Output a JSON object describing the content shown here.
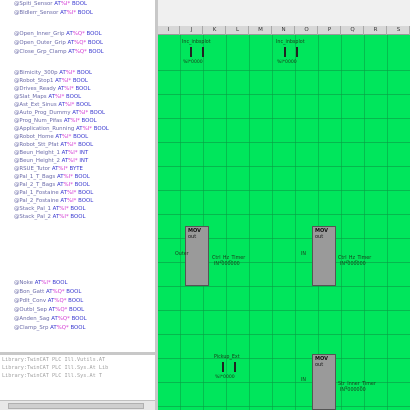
{
  "variables": [
    {
      "name": "@Spiti_Sensor",
      "at": "AT",
      "addr": "%I*",
      "type": "BOOL"
    },
    {
      "name": "@Bldlerr_Sensor",
      "at": "AT",
      "addr": "%I*",
      "type": "BOOL"
    },
    {
      "name": "@Open_Inner_Grip",
      "at": "AT",
      "addr": "%Q*",
      "type": "BOOL"
    },
    {
      "name": "@Open_Outer_Grip",
      "at": "AT",
      "addr": "%Q*",
      "type": "BOOL"
    },
    {
      "name": "@Close_Grp_Clamp",
      "at": "AT",
      "addr": "%Q*",
      "type": "BOOL"
    },
    {
      "name": "@Bimicity_300p",
      "at": "AT",
      "addr": "%I*",
      "type": "BOOL"
    },
    {
      "name": "@Robot_Stop1",
      "at": "AT",
      "addr": "%I*",
      "type": "BOOL"
    },
    {
      "name": "@Drives_Ready",
      "at": "AT",
      "addr": "%I*",
      "type": "BOOL"
    },
    {
      "name": "@Slat_Maps",
      "at": "AT",
      "addr": "%I*",
      "type": "BOOL"
    },
    {
      "name": "@Ast_Ext_Sinus",
      "at": "AT",
      "addr": "%I*",
      "type": "BOOL"
    },
    {
      "name": "@Auto_Prog_Dummy",
      "at": "AT",
      "addr": "%I*",
      "type": "BOOL"
    },
    {
      "name": "@Prog_Num_Pifas",
      "at": "AT",
      "addr": "%I*",
      "type": "BOOL"
    },
    {
      "name": "@Application_Running",
      "at": "AT",
      "addr": "%I*",
      "type": "BOOL"
    },
    {
      "name": "@Robot_Home",
      "at": "AT",
      "addr": "%I*",
      "type": "BOOL"
    },
    {
      "name": "@Robot_Stt_Pfat",
      "at": "AT",
      "addr": "%I*",
      "type": "BOOL"
    },
    {
      "name": "@Beun_Height_1",
      "at": "AT",
      "addr": "%I*",
      "type": "INT"
    },
    {
      "name": "@Beun_Height_2",
      "at": "AT",
      "addr": "%I*",
      "type": "INT"
    },
    {
      "name": "@RSUE_Tutor",
      "at": "AT",
      "addr": "%I*",
      "type": "BYTE"
    },
    {
      "name": "@Pal_1_T_Bags",
      "at": "AT",
      "addr": "%I*",
      "type": "BOOL"
    },
    {
      "name": "@Pal_2_T_Bags",
      "at": "AT",
      "addr": "%I*",
      "type": "BOOL"
    },
    {
      "name": "@Pal_1_Fostaine",
      "at": "AT",
      "addr": "%I*",
      "type": "BOOL"
    },
    {
      "name": "@Pal_2_Fostaine",
      "at": "AT",
      "addr": "%I*",
      "type": "BOOL"
    },
    {
      "name": "@Stack_Pal_1",
      "at": "AT",
      "addr": "%I*",
      "type": "BOOL"
    },
    {
      "name": "@Stack_Pal_2",
      "at": "AT",
      "addr": "%I*",
      "type": "BOOL"
    },
    {
      "name": "@Noke",
      "at": "AT",
      "addr": "%I*",
      "type": "BOOL"
    },
    {
      "name": "@Bon_Gatt",
      "at": "AT",
      "addr": "%Q*",
      "type": "BOOL"
    },
    {
      "name": "@Pdlt_Conv",
      "at": "AT",
      "addr": "%Q*",
      "type": "BOOL"
    },
    {
      "name": "@Outbl_Sep",
      "at": "AT",
      "addr": "%Q*",
      "type": "BOOL"
    },
    {
      "name": "@Anden_Sag",
      "at": "AT",
      "addr": "%Q*",
      "type": "BOOL"
    },
    {
      "name": "@Clamp_Srp",
      "at": "AT",
      "addr": "%Q*",
      "type": "BOOL"
    }
  ],
  "output_lines": [
    "Library:TwinCAT PLC Ill.Vutils.AT",
    "Library:TwinCAT PLC Ill.Sys.At Lib",
    "Library:TwinCAT PLC Ill.Sys.At T",
    ""
  ],
  "ladder": {
    "column_letters": [
      "I",
      "J",
      "K",
      "L",
      "M",
      "N",
      "O",
      "P",
      "Q",
      "R",
      "S"
    ],
    "contacts": [
      {
        "label": "Inc_inbsplot",
        "address": "%I*0000"
      },
      {
        "label": "Inc_inbsplot",
        "address": "%I*0000"
      },
      {
        "label": "Pickup_Ext",
        "address": "%I*0000"
      }
    ],
    "blocks": [
      {
        "title": "MOV",
        "sub": "out",
        "in": "Outer",
        "out": "Ctrl_Hz_Timer",
        "out2": "IN*000000"
      },
      {
        "title": "MOV",
        "sub": "out",
        "in": "IN",
        "out": "Ctrl_Hz_Timer",
        "out2": "IN*000000"
      },
      {
        "title": "MOV",
        "sub": "out",
        "in": "IN",
        "out": "Str_Inner_Timer",
        "out2": "IN*000000"
      }
    ]
  },
  "colors": {
    "ladder_background": "#00e65c",
    "var_name": "#6a6aa8",
    "var_at": "#3a3ad0",
    "var_address": "#d33ad3"
  }
}
